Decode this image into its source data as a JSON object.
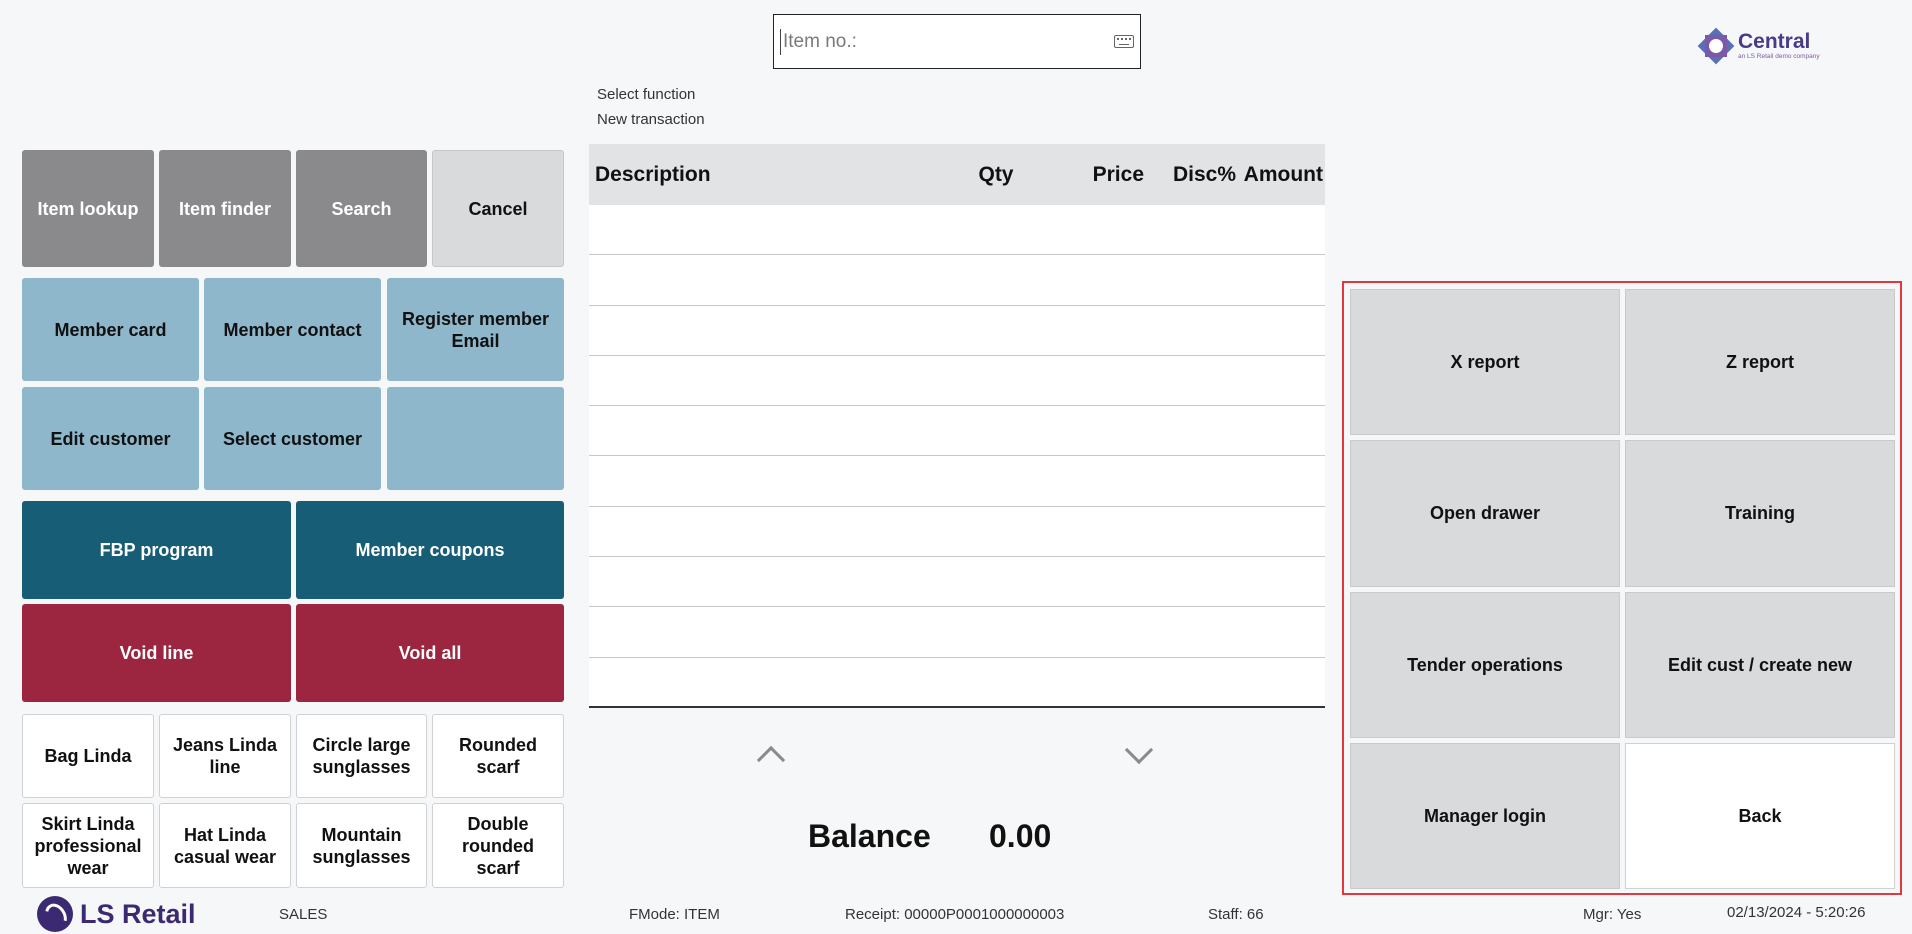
{
  "search": {
    "placeholder": "Item no.:"
  },
  "brand": {
    "top_logo": "Central",
    "top_logo_sub": "an LS Retail demo company",
    "bottom_logo": "LS Retail"
  },
  "info": {
    "line1": "Select function",
    "line2": "New transaction"
  },
  "left_buttons": {
    "row1": [
      "Item lookup",
      "Item finder",
      "Search",
      "Cancel"
    ],
    "member": [
      "Member card",
      "Member contact",
      "Register member Email",
      "Edit customer",
      "Select customer",
      ""
    ],
    "program": [
      "FBP program",
      "Member coupons"
    ],
    "void": [
      "Void line",
      "Void all"
    ],
    "items": [
      "Bag Linda",
      "Jeans Linda line",
      "Circle large sunglasses",
      "Rounded scarf",
      "Skirt Linda professional wear",
      "Hat Linda casual wear",
      "Mountain sunglasses",
      "Double rounded scarf"
    ]
  },
  "table": {
    "headers": {
      "description": "Description",
      "qty": "Qty",
      "price": "Price",
      "disc": "Disc%",
      "amount": "Amount"
    },
    "rows": 10
  },
  "balance": {
    "label": "Balance",
    "value": "0.00"
  },
  "functions": [
    "X report",
    "Z report",
    "Open drawer",
    "Training",
    "Tender operations",
    "Edit cust / create new",
    "Manager login",
    "Back"
  ],
  "status": {
    "mode": "SALES",
    "fmode": "FMode: ITEM",
    "receipt": "Receipt: 00000P0001000000003",
    "staff": "Staff: 66",
    "mgr": "Mgr: Yes",
    "datetime": "02/13/2024 - 5:20:26"
  },
  "colors": {
    "accent_panel_border": "#e0383e",
    "teal": "#175d76",
    "red": "#9c2640",
    "member_blue": "#8fb7cc"
  }
}
